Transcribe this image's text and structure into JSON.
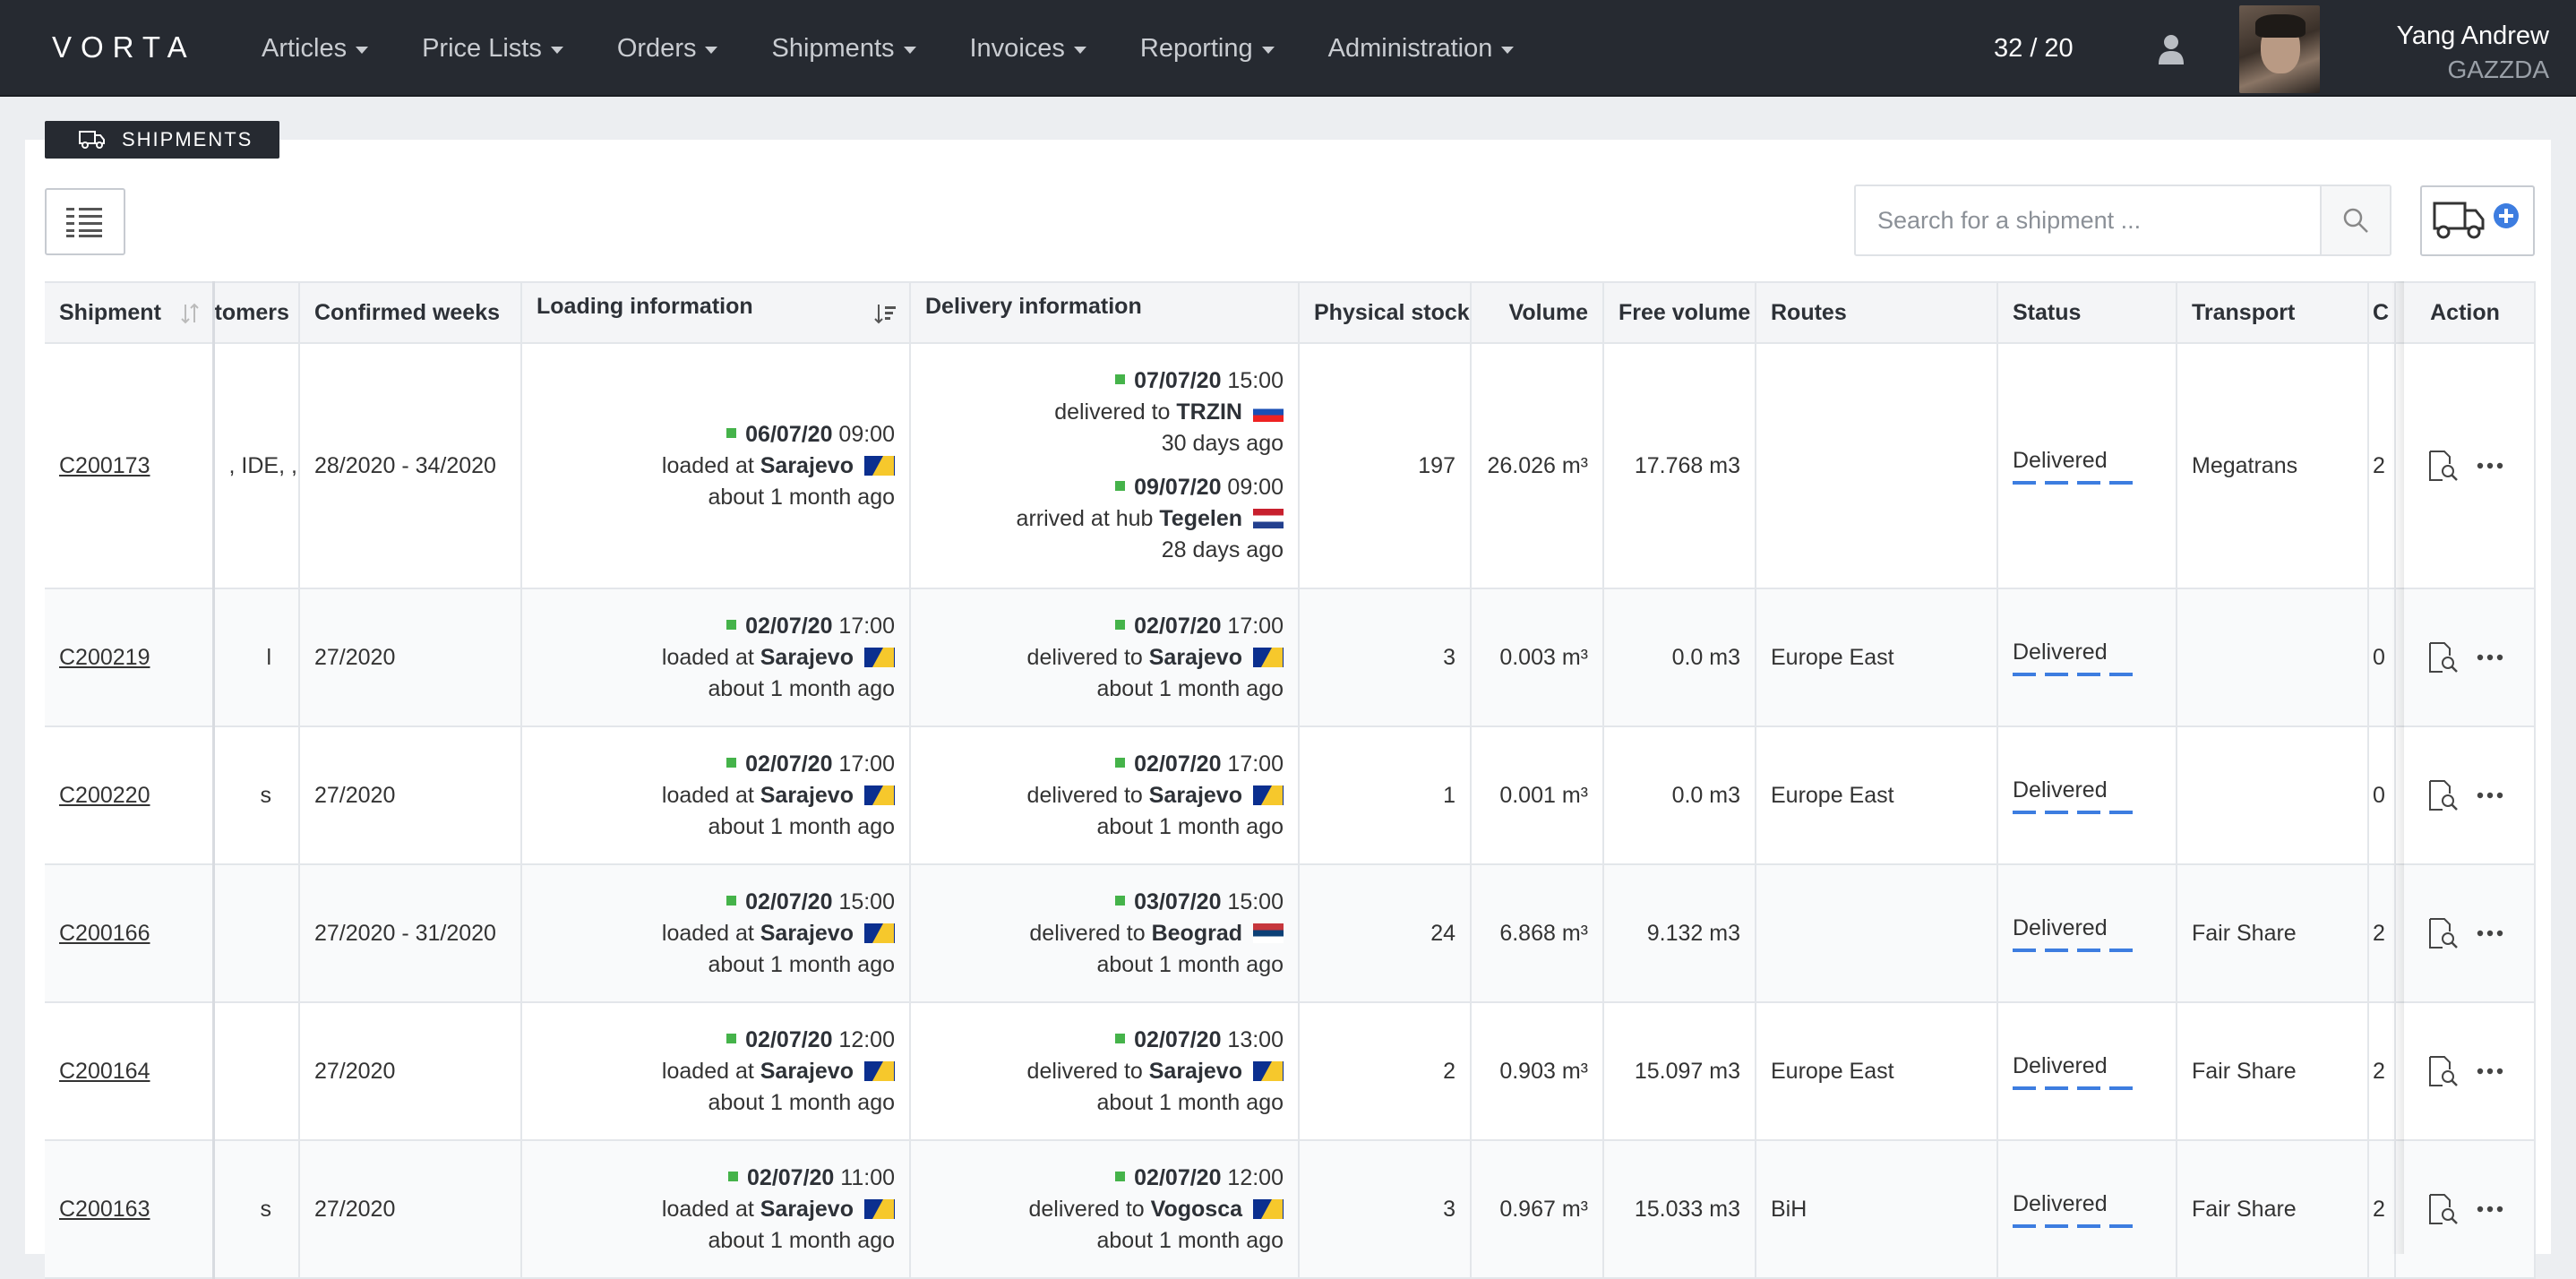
{
  "nav": {
    "brand": "VORTA",
    "items": [
      {
        "label": "Articles"
      },
      {
        "label": "Price Lists"
      },
      {
        "label": "Orders"
      },
      {
        "label": "Shipments"
      },
      {
        "label": "Invoices"
      },
      {
        "label": "Reporting"
      },
      {
        "label": "Administration"
      }
    ],
    "counter": "32 / 20",
    "user_name": "Yang Andrew",
    "user_org": "GAZZDA"
  },
  "page": {
    "section_title": "SHIPMENTS",
    "search_placeholder": "Search for a shipment ..."
  },
  "table": {
    "headers": {
      "shipment": "Shipment",
      "customers": "tomers",
      "confirmed_weeks": "Confirmed weeks",
      "loading": "Loading information",
      "delivery": "Delivery information",
      "physical_stock": "Physical stock",
      "volume": "Volume",
      "free_volume": "Free volume",
      "routes": "Routes",
      "status": "Status",
      "transport": "Transport",
      "clipped": "C",
      "action": "Action"
    },
    "rows": [
      {
        "shipment": "C200173",
        "customers": ", IDE,\n, TAF,\nR, FLI,\n, STA,\n, ELE,\n, MOT,\n, TGK",
        "confirmed_weeks": "28/2020 - 34/2020",
        "loading": {
          "datetime_bold": "06/07/20",
          "time": "09:00",
          "prefix": "loaded at",
          "place": "Sarajevo",
          "ago": "about 1 month ago"
        },
        "delivery": [
          {
            "datetime_bold": "07/07/20",
            "time": "15:00",
            "prefix": "delivered to",
            "place": "TRZIN",
            "ago": "30 days ago"
          },
          {
            "datetime_bold": "09/07/20",
            "time": "09:00",
            "prefix": "arrived at hub",
            "place": "Tegelen",
            "ago": "28 days ago"
          }
        ],
        "physical_stock": "197",
        "volume": "26.026 m³",
        "free_volume": "17.768 m3",
        "routes": "",
        "status": "Delivered",
        "transport": "Megatrans",
        "clipped": "2"
      },
      {
        "shipment": "C200219",
        "customers": "l",
        "confirmed_weeks": "27/2020",
        "loading": {
          "datetime_bold": "02/07/20",
          "time": "17:00",
          "prefix": "loaded at",
          "place": "Sarajevo",
          "ago": "about 1 month ago"
        },
        "delivery": [
          {
            "datetime_bold": "02/07/20",
            "time": "17:00",
            "prefix": "delivered to",
            "place": "Sarajevo",
            "ago": "about 1 month ago"
          }
        ],
        "physical_stock": "3",
        "volume": "0.003 m³",
        "free_volume": "0.0 m3",
        "routes": "Europe East",
        "status": "Delivered",
        "transport": "",
        "clipped": "0"
      },
      {
        "shipment": "C200220",
        "customers": "s",
        "confirmed_weeks": "27/2020",
        "loading": {
          "datetime_bold": "02/07/20",
          "time": "17:00",
          "prefix": "loaded at",
          "place": "Sarajevo",
          "ago": "about 1 month ago"
        },
        "delivery": [
          {
            "datetime_bold": "02/07/20",
            "time": "17:00",
            "prefix": "delivered to",
            "place": "Sarajevo",
            "ago": "about 1 month ago"
          }
        ],
        "physical_stock": "1",
        "volume": "0.001 m³",
        "free_volume": "0.0 m3",
        "routes": "Europe East",
        "status": "Delivered",
        "transport": "",
        "clipped": "0"
      },
      {
        "shipment": "C200166",
        "customers": "",
        "confirmed_weeks": "27/2020 - 31/2020",
        "loading": {
          "datetime_bold": "02/07/20",
          "time": "15:00",
          "prefix": "loaded at",
          "place": "Sarajevo",
          "ago": "about 1 month ago"
        },
        "delivery": [
          {
            "datetime_bold": "03/07/20",
            "time": "15:00",
            "prefix": "delivered to",
            "place": "Beograd",
            "ago": "about 1 month ago"
          }
        ],
        "physical_stock": "24",
        "volume": "6.868 m³",
        "free_volume": "9.132 m3",
        "routes": "",
        "status": "Delivered",
        "transport": "Fair Share",
        "clipped": "2"
      },
      {
        "shipment": "C200164",
        "customers": "",
        "confirmed_weeks": "27/2020",
        "loading": {
          "datetime_bold": "02/07/20",
          "time": "12:00",
          "prefix": "loaded at",
          "place": "Sarajevo",
          "ago": "about 1 month ago"
        },
        "delivery": [
          {
            "datetime_bold": "02/07/20",
            "time": "13:00",
            "prefix": "delivered to",
            "place": "Sarajevo",
            "ago": "about 1 month ago"
          }
        ],
        "physical_stock": "2",
        "volume": "0.903 m³",
        "free_volume": "15.097 m3",
        "routes": "Europe East",
        "status": "Delivered",
        "transport": "Fair Share",
        "clipped": "2"
      },
      {
        "shipment": "C200163",
        "customers": "s",
        "confirmed_weeks": "27/2020",
        "loading": {
          "datetime_bold": "02/07/20",
          "time": "11:00",
          "prefix": "loaded at",
          "place": "Sarajevo",
          "ago": "about 1 month ago"
        },
        "delivery": [
          {
            "datetime_bold": "02/07/20",
            "time": "12:00",
            "prefix": "delivered to",
            "place": "Vogosca",
            "ago": "about 1 month ago"
          }
        ],
        "physical_stock": "3",
        "volume": "0.967 m³",
        "free_volume": "15.033 m3",
        "routes": "BiH",
        "status": "Delivered",
        "transport": "Fair Share",
        "clipped": "2"
      }
    ]
  },
  "flags": {
    "loading": [
      "flag-ba",
      "flag-ba",
      "flag-ba",
      "flag-ba",
      "flag-ba",
      "flag-ba"
    ],
    "delivery": [
      [
        "flag-si",
        "flag-nl"
      ],
      [
        "flag-ba"
      ],
      [
        "flag-ba"
      ],
      [
        "flag-rs"
      ],
      [
        "flag-ba"
      ],
      [
        "flag-ba"
      ]
    ]
  },
  "colors": {
    "navbar": "#262a31",
    "accent_blue": "#3d7de0",
    "status_green": "#45b34a"
  }
}
